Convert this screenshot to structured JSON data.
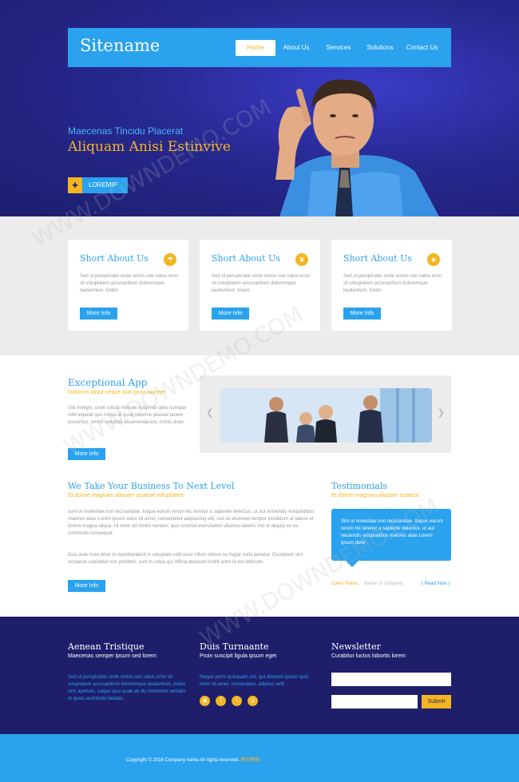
{
  "header": {
    "logo": "Sitename",
    "nav": [
      {
        "label": "Home",
        "active": true
      },
      {
        "label": "About Us"
      },
      {
        "label": "Services"
      },
      {
        "label": "Solutions"
      },
      {
        "label": "Contact Us"
      }
    ]
  },
  "hero": {
    "subtitle": "Maecenas Tincidu Placerat",
    "title": "Aliquam Anisi Estinvive",
    "button": "LOREMIP"
  },
  "features": [
    {
      "title": "Short About Us",
      "icon": "umbrella-icon",
      "text": "Sed ut perspiciatis unde omnis iste natus error sit voluptatem accusantium doloremque laudantium, totam",
      "button": "More Info"
    },
    {
      "title": "Short About Us",
      "icon": "trophy-icon",
      "text": "Sed ut perspiciatis unde omnis iste natus error sit voluptatem accusantium doloremque laudantium, totam",
      "button": "More Info"
    },
    {
      "title": "Short About Us",
      "icon": "star-icon",
      "text": "Sed ut perspiciatis unde omnis iste natus error sit voluptatem accusantium doloremque laudantium, totam",
      "button": "More Info"
    }
  ],
  "app": {
    "title": "Exceptional App",
    "subtitle": "Dolorum aliqui neque quis gravi laoreet",
    "text": "Ulis ineligni, unde soluta metuae euigendi optio cumque nihil impedit quo minus id quod maxime placeat facere possimus, omnis voluptas assumenda est, omnis dolor.",
    "button": "More Info"
  },
  "business": {
    "title": "We Take Your Business To Next Level",
    "subtitle": "Et dolore magnam aliquam quaerat voluptatem.",
    "p1": "sunt ut molestiae non recusandae. Itaque earum rerum hic tenetur a sapiente delectus, ut aut reiciendis voluptatibus maiores alias Lorem ipsum dolor sit amet, consectetur adipisicing elit, sed do eiusmod tempor incididunt ut labore et dolore magna aliqua. Ut enim ad minim veniam, quis nostrud exercitation ullamco laboris nisi ut aliquip ex ea commodo consequat.",
    "p2": "Duis aute irure dolor in reprehenderit in voluptate velit esse cillum dolore eu fugiat nulla pariatur. Excepteur sint occaecat cupidatat non proident, sunt in culpa qui officia deserunt mollit anim id est laborum.",
    "button": "More Info"
  },
  "testimonials": {
    "title": "Testimonials",
    "subtitle": "Et dolore magnam aliquam quaerat",
    "text": "Sint ut molestiae non recusandae. Itaque earum rerum hic tenetur a sapiente delectus, ut aut reiciendis voluptatibus maiores alias Lorem ipsum dolor",
    "client": "Client Name",
    "company": "Name of company",
    "read_now": "( Read Now )"
  },
  "footer": {
    "col1": {
      "title": "Aenean Tristique",
      "sub": "Maecenas semper ipsum sed lorem",
      "text": "Sed ut perspiciatis unde omnis iste natus error sit voluptatem accusantium doloremque laudantium, totam rem aperiam, eaque ipsa quae ab illo inventore veritatis et quasi architecto beatae."
    },
    "col2": {
      "title": "Duis Turnaante",
      "sub": "Proin suscipit ligula ipsum eget",
      "text": "Neque porro quisquam est, qui dolorem ipsum quia dolor sit amet, consectetur, adipisci velit."
    },
    "col3": {
      "title": "Newsletter",
      "sub": "Curabitur luctus lobortis lorem",
      "submit": "Submit"
    },
    "social": [
      "rss-icon",
      "facebook-icon",
      "twitter-icon",
      "dribbble-icon"
    ]
  },
  "copyright": {
    "text": "Copyright © 2016 Company name All rights reserved.",
    "link": "网页模板"
  },
  "watermark": "WWW.DOWNDEMO.COM",
  "colors": {
    "accent": "#2aa2ee",
    "gold": "#f4b521",
    "navy": "#1e1e6b"
  }
}
